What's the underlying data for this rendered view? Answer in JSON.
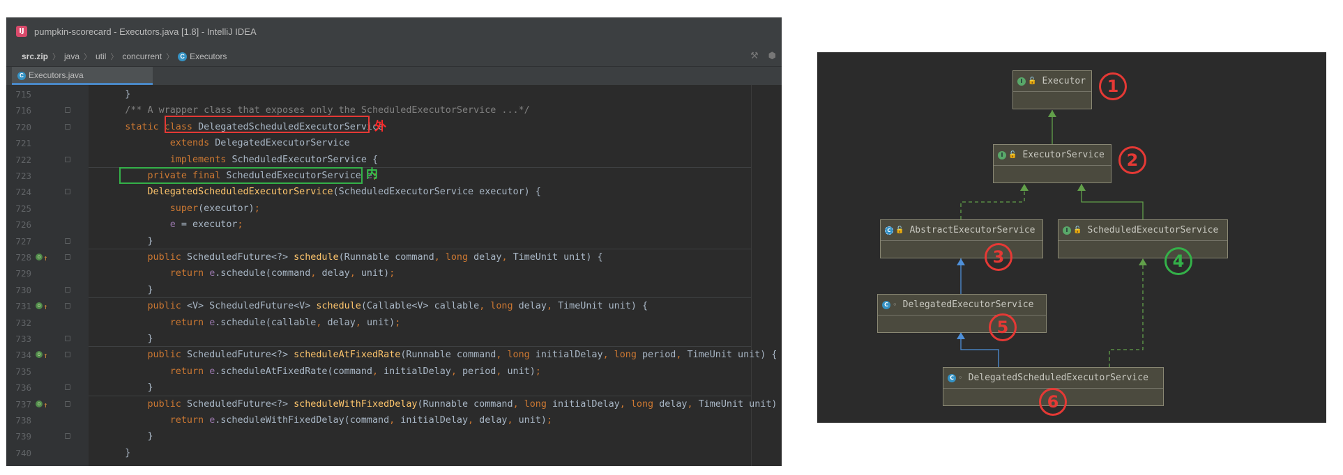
{
  "window": {
    "title": "pumpkin-scorecard - Executors.java [1.8] - IntelliJ IDEA",
    "app_icon": "IJ"
  },
  "breadcrumb": [
    "src.zip",
    "java",
    "util",
    "concurrent",
    "Executors"
  ],
  "tab": {
    "label": "Executors.java"
  },
  "editor": {
    "lines": [
      {
        "n": "715",
        "parts": [
          [
            "plain",
            "    }"
          ]
        ]
      },
      {
        "n": "716",
        "parts": [
          [
            "cm",
            "    /** A wrapper class that exposes only the ScheduledExecutorService ...*/"
          ]
        ]
      },
      {
        "n": "720",
        "parts": [
          [
            "kw",
            "    static class "
          ],
          [
            "plain",
            "DelegatedScheduledExecutorService"
          ]
        ]
      },
      {
        "n": "721",
        "parts": [
          [
            "kw",
            "            extends "
          ],
          [
            "plain",
            "DelegatedExecutorService"
          ]
        ]
      },
      {
        "n": "722",
        "parts": [
          [
            "kw",
            "            implements "
          ],
          [
            "plain",
            "ScheduledExecutorService {"
          ]
        ]
      },
      {
        "n": "723",
        "parts": [
          [
            "kw",
            "        private final "
          ],
          [
            "plain",
            "ScheduledExecutorService "
          ],
          [
            "fld",
            "e"
          ],
          [
            "kw",
            ";"
          ]
        ]
      },
      {
        "n": "724",
        "parts": [
          [
            "fn",
            "        DelegatedScheduledExecutorService"
          ],
          [
            "plain",
            "(ScheduledExecutorService executor) {"
          ]
        ]
      },
      {
        "n": "725",
        "parts": [
          [
            "kw",
            "            super"
          ],
          [
            "plain",
            "(executor)"
          ],
          [
            "kw",
            ";"
          ]
        ]
      },
      {
        "n": "726",
        "parts": [
          [
            "fld",
            "            e"
          ],
          [
            "plain",
            " = executor"
          ],
          [
            "kw",
            ";"
          ]
        ]
      },
      {
        "n": "727",
        "parts": [
          [
            "plain",
            "        }"
          ]
        ]
      },
      {
        "n": "728",
        "parts": [
          [
            "kw",
            "        public "
          ],
          [
            "plain",
            "ScheduledFuture<?> "
          ],
          [
            "fn",
            "schedule"
          ],
          [
            "plain",
            "(Runnable command"
          ],
          [
            "kw",
            ", long "
          ],
          [
            "plain",
            "delay"
          ],
          [
            "kw",
            ", "
          ],
          [
            "plain",
            "TimeUnit unit) {"
          ]
        ]
      },
      {
        "n": "729",
        "parts": [
          [
            "kw",
            "            return "
          ],
          [
            "fld",
            "e"
          ],
          [
            "plain",
            ".schedule(command"
          ],
          [
            "kw",
            ", "
          ],
          [
            "plain",
            "delay"
          ],
          [
            "kw",
            ", "
          ],
          [
            "plain",
            "unit)"
          ],
          [
            "kw",
            ";"
          ]
        ]
      },
      {
        "n": "730",
        "parts": [
          [
            "plain",
            "        }"
          ]
        ]
      },
      {
        "n": "731",
        "parts": [
          [
            "kw",
            "        public "
          ],
          [
            "plain",
            "<V> ScheduledFuture<V> "
          ],
          [
            "fn",
            "schedule"
          ],
          [
            "plain",
            "(Callable<V> callable"
          ],
          [
            "kw",
            ", long "
          ],
          [
            "plain",
            "delay"
          ],
          [
            "kw",
            ", "
          ],
          [
            "plain",
            "TimeUnit unit) {"
          ]
        ]
      },
      {
        "n": "732",
        "parts": [
          [
            "kw",
            "            return "
          ],
          [
            "fld",
            "e"
          ],
          [
            "plain",
            ".schedule(callable"
          ],
          [
            "kw",
            ", "
          ],
          [
            "plain",
            "delay"
          ],
          [
            "kw",
            ", "
          ],
          [
            "plain",
            "unit)"
          ],
          [
            "kw",
            ";"
          ]
        ]
      },
      {
        "n": "733",
        "parts": [
          [
            "plain",
            "        }"
          ]
        ]
      },
      {
        "n": "734",
        "parts": [
          [
            "kw",
            "        public "
          ],
          [
            "plain",
            "ScheduledFuture<?> "
          ],
          [
            "fn",
            "scheduleAtFixedRate"
          ],
          [
            "plain",
            "(Runnable command"
          ],
          [
            "kw",
            ", long "
          ],
          [
            "plain",
            "initialDelay"
          ],
          [
            "kw",
            ", long "
          ],
          [
            "plain",
            "period"
          ],
          [
            "kw",
            ", "
          ],
          [
            "plain",
            "TimeUnit unit) {"
          ]
        ]
      },
      {
        "n": "735",
        "parts": [
          [
            "kw",
            "            return "
          ],
          [
            "fld",
            "e"
          ],
          [
            "plain",
            ".scheduleAtFixedRate(command"
          ],
          [
            "kw",
            ", "
          ],
          [
            "plain",
            "initialDelay"
          ],
          [
            "kw",
            ", "
          ],
          [
            "plain",
            "period"
          ],
          [
            "kw",
            ", "
          ],
          [
            "plain",
            "unit)"
          ],
          [
            "kw",
            ";"
          ]
        ]
      },
      {
        "n": "736",
        "parts": [
          [
            "plain",
            "        }"
          ]
        ]
      },
      {
        "n": "737",
        "parts": [
          [
            "kw",
            "        public "
          ],
          [
            "plain",
            "ScheduledFuture<?> "
          ],
          [
            "fn",
            "scheduleWithFixedDelay"
          ],
          [
            "plain",
            "(Runnable command"
          ],
          [
            "kw",
            ", long "
          ],
          [
            "plain",
            "initialDelay"
          ],
          [
            "kw",
            ", long "
          ],
          [
            "plain",
            "delay"
          ],
          [
            "kw",
            ", "
          ],
          [
            "plain",
            "TimeUnit unit) {"
          ]
        ]
      },
      {
        "n": "738",
        "parts": [
          [
            "kw",
            "            return "
          ],
          [
            "fld",
            "e"
          ],
          [
            "plain",
            ".scheduleWithFixedDelay(command"
          ],
          [
            "kw",
            ", "
          ],
          [
            "plain",
            "initialDelay"
          ],
          [
            "kw",
            ", "
          ],
          [
            "plain",
            "delay"
          ],
          [
            "kw",
            ", "
          ],
          [
            "plain",
            "unit)"
          ],
          [
            "kw",
            ";"
          ]
        ]
      },
      {
        "n": "739",
        "parts": [
          [
            "plain",
            "        }"
          ]
        ]
      },
      {
        "n": "740",
        "parts": [
          [
            "plain",
            "    }"
          ]
        ]
      }
    ],
    "annotations": {
      "outer": "外",
      "inner": "内"
    }
  },
  "diagram": {
    "nodes": [
      {
        "id": "executor",
        "label": "Executor",
        "kind": "interface",
        "number": "1",
        "number_color": "#e53935"
      },
      {
        "id": "executor-service",
        "label": "ExecutorService",
        "kind": "interface",
        "number": "2",
        "number_color": "#e53935"
      },
      {
        "id": "abstract-executor-service",
        "label": "AbstractExecutorService",
        "kind": "abstract-class",
        "number": "3",
        "number_color": "#e53935"
      },
      {
        "id": "scheduled-executor-service",
        "label": "ScheduledExecutorService",
        "kind": "interface",
        "number": "4",
        "number_color": "#34b149"
      },
      {
        "id": "delegated-executor-service",
        "label": "DelegatedExecutorService",
        "kind": "class",
        "number": "5",
        "number_color": "#e53935"
      },
      {
        "id": "delegated-scheduled-executor-service",
        "label": "DelegatedScheduledExecutorService",
        "kind": "class",
        "number": "6",
        "number_color": "#e53935"
      }
    ],
    "edges": [
      {
        "from": "executor-service",
        "to": "executor",
        "type": "extends"
      },
      {
        "from": "abstract-executor-service",
        "to": "executor-service",
        "type": "implements"
      },
      {
        "from": "scheduled-executor-service",
        "to": "executor-service",
        "type": "extends"
      },
      {
        "from": "delegated-executor-service",
        "to": "abstract-executor-service",
        "type": "extends"
      },
      {
        "from": "delegated-scheduled-executor-service",
        "to": "delegated-executor-service",
        "type": "extends"
      },
      {
        "from": "delegated-scheduled-executor-service",
        "to": "scheduled-executor-service",
        "type": "implements"
      }
    ],
    "colors": {
      "extends_interface": "#62a04a",
      "extends_class": "#4e8fd8",
      "implements": "#62a04a"
    }
  }
}
